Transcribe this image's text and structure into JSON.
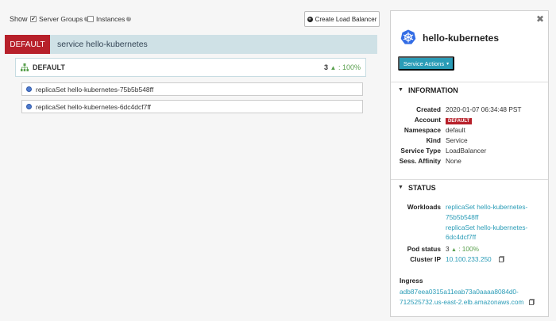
{
  "toolbar": {
    "show_label": "Show",
    "server_groups": {
      "label": "Server Groups",
      "checked": true
    },
    "instances": {
      "label": "Instances",
      "checked": false
    },
    "create_button": "Create Load Balancer"
  },
  "load_balancer": {
    "account_badge": "DEFAULT",
    "title": "service hello-kubernetes"
  },
  "server_group": {
    "name": "DEFAULT",
    "count": "3",
    "health": ": 100%"
  },
  "replica_sets": [
    "replicaSet hello-kubernetes-75b5b548ff",
    "replicaSet hello-kubernetes-6dc4dcf7ff"
  ],
  "details": {
    "title": "hello-kubernetes",
    "actions_button": "Service Actions",
    "information": {
      "header": "INFORMATION",
      "rows": [
        {
          "key": "Created",
          "value": "2020-01-07 06:34:48 PST"
        },
        {
          "key": "Account",
          "value": "DEFAULT"
        },
        {
          "key": "Namespace",
          "value": "default"
        },
        {
          "key": "Kind",
          "value": "Service"
        },
        {
          "key": "Service Type",
          "value": "LoadBalancer"
        },
        {
          "key": "Sess. Affinity",
          "value": "None"
        }
      ]
    },
    "status": {
      "header": "STATUS",
      "workloads_label": "Workloads",
      "workloads": [
        [
          "replicaSet hello-kubernetes-",
          "75b5b548ff"
        ],
        [
          "replicaSet hello-kubernetes-",
          "6dc4dcf7ff"
        ]
      ],
      "pod_status_label": "Pod status",
      "pod_status_count": "3",
      "pod_status_pct": ": 100%",
      "cluster_ip_label": "Cluster IP",
      "cluster_ip": "10.100.233.250",
      "ingress_label": "Ingress",
      "ingress": [
        "adb87eea0315a11eab73a0aaaa8084d0-",
        "712525732.us-east-2.elb.amazonaws.com"
      ]
    }
  },
  "colors": {
    "accent": "#2a9cb7",
    "danger": "#b7202a",
    "healthy": "#5aa04e",
    "lb_header_bg": "#cfe1e6"
  }
}
